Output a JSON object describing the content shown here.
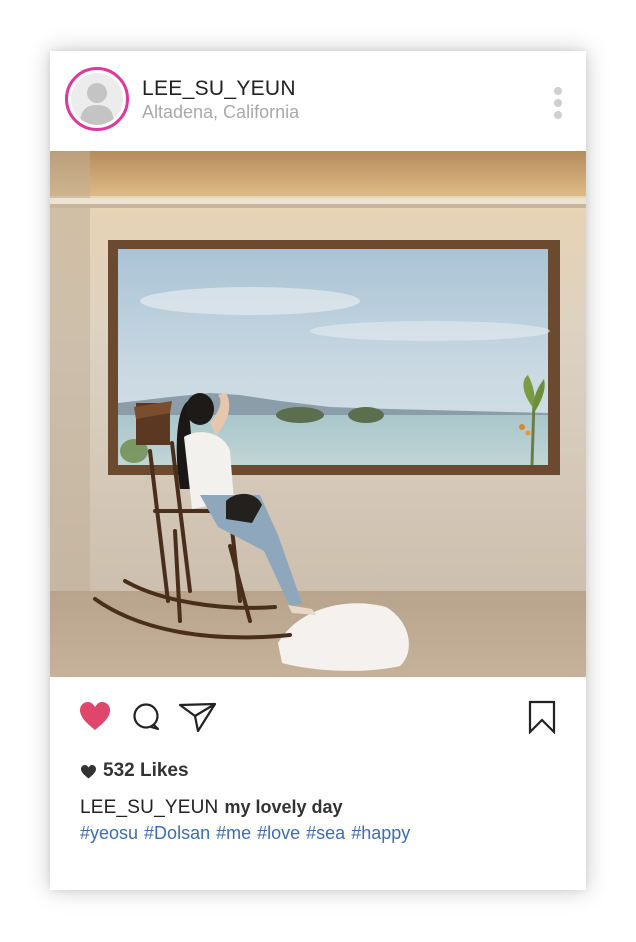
{
  "post": {
    "username": "LEE_SU_YEUN",
    "location": "Altadena, California",
    "likes_count": "532",
    "likes_label": "Likes",
    "caption_user": "LEE_SU_YEUN",
    "caption_text": "my lovely day",
    "hashtags": [
      "#yeosu",
      "#Dolsan",
      "#me",
      "#love",
      "#sea",
      "#happy"
    ],
    "liked": true
  },
  "colors": {
    "avatar_ring": "#e0369e",
    "heart": "#e0456b",
    "hashtag": "#3c6db3"
  },
  "icons": [
    "avatar-icon",
    "more-icon",
    "heart-icon",
    "comment-icon",
    "share-icon",
    "bookmark-icon",
    "small-heart-icon"
  ]
}
